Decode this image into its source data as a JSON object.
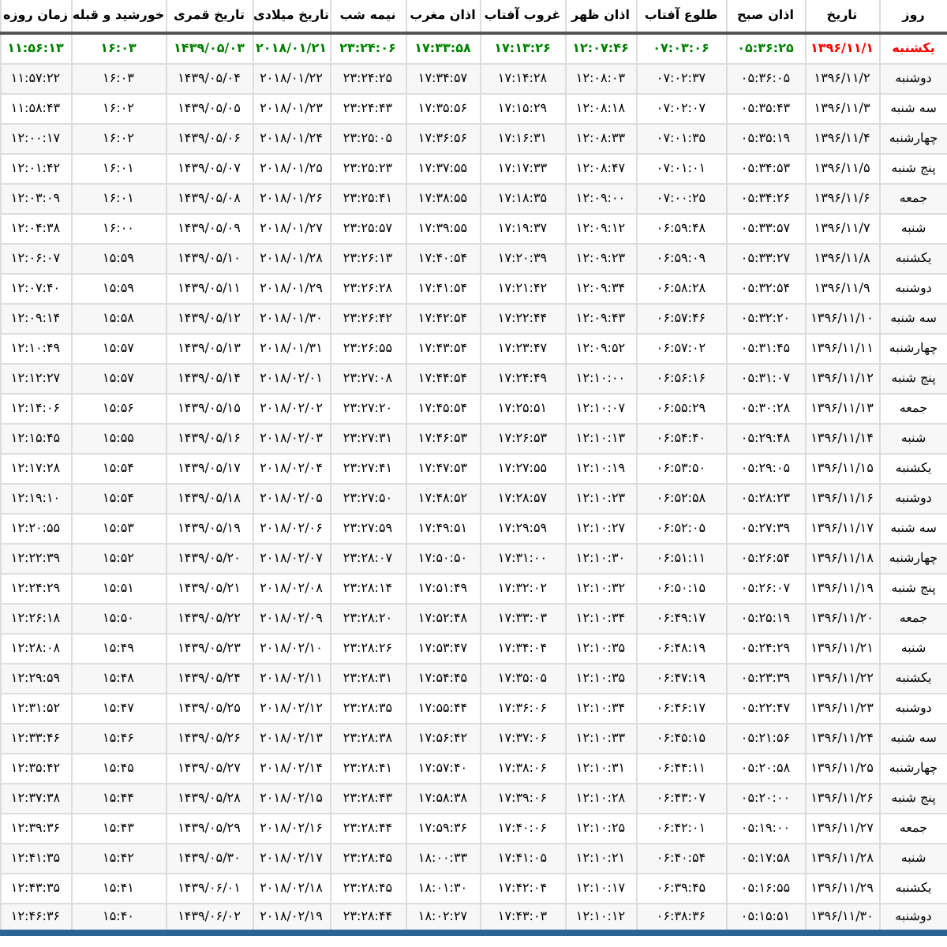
{
  "columns": [
    "روز",
    "تاریخ",
    "اذان صبح",
    "طلوع آفتاب",
    "اذان ظهر",
    "غروب آفتاب",
    "اذان مغرب",
    "نیمه شب",
    "تاریخ میلادی",
    "تاریخ قمری",
    "خورشید و قبله",
    "زمان روزه"
  ],
  "rows": [
    {
      "today": true,
      "cells": [
        "یکشنبه",
        "۱۳۹۶/۱۱/۱",
        "۰۵:۳۶:۲۵",
        "۰۷:۰۳:۰۶",
        "۱۲:۰۷:۴۶",
        "۱۷:۱۳:۲۶",
        "۱۷:۳۳:۵۸",
        "۲۳:۲۴:۰۶",
        "۲۰۱۸/۰۱/۲۱",
        "۱۴۳۹/۰۵/۰۳",
        "۱۶:۰۳",
        "۱۱:۵۶:۱۳"
      ]
    },
    {
      "today": false,
      "cells": [
        "دوشنبه",
        "۱۳۹۶/۱۱/۲",
        "۰۵:۳۶:۰۵",
        "۰۷:۰۲:۳۷",
        "۱۲:۰۸:۰۳",
        "۱۷:۱۴:۲۸",
        "۱۷:۳۴:۵۷",
        "۲۳:۲۴:۲۵",
        "۲۰۱۸/۰۱/۲۲",
        "۱۴۳۹/۰۵/۰۴",
        "۱۶:۰۳",
        "۱۱:۵۷:۲۲"
      ]
    },
    {
      "today": false,
      "cells": [
        "سه شنبه",
        "۱۳۹۶/۱۱/۳",
        "۰۵:۳۵:۴۳",
        "۰۷:۰۲:۰۷",
        "۱۲:۰۸:۱۸",
        "۱۷:۱۵:۲۹",
        "۱۷:۳۵:۵۶",
        "۲۳:۲۴:۴۳",
        "۲۰۱۸/۰۱/۲۳",
        "۱۴۳۹/۰۵/۰۵",
        "۱۶:۰۲",
        "۱۱:۵۸:۴۳"
      ]
    },
    {
      "today": false,
      "cells": [
        "چهارشنبه",
        "۱۳۹۶/۱۱/۴",
        "۰۵:۳۵:۱۹",
        "۰۷:۰۱:۳۵",
        "۱۲:۰۸:۳۳",
        "۱۷:۱۶:۳۱",
        "۱۷:۳۶:۵۶",
        "۲۳:۲۵:۰۵",
        "۲۰۱۸/۰۱/۲۴",
        "۱۴۳۹/۰۵/۰۶",
        "۱۶:۰۲",
        "۱۲:۰۰:۱۷"
      ]
    },
    {
      "today": false,
      "cells": [
        "پنج شنبه",
        "۱۳۹۶/۱۱/۵",
        "۰۵:۳۴:۵۳",
        "۰۷:۰۱:۰۱",
        "۱۲:۰۸:۴۷",
        "۱۷:۱۷:۳۳",
        "۱۷:۳۷:۵۵",
        "۲۳:۲۵:۲۳",
        "۲۰۱۸/۰۱/۲۵",
        "۱۴۳۹/۰۵/۰۷",
        "۱۶:۰۱",
        "۱۲:۰۱:۴۲"
      ]
    },
    {
      "today": false,
      "cells": [
        "جمعه",
        "۱۳۹۶/۱۱/۶",
        "۰۵:۳۴:۲۶",
        "۰۷:۰۰:۲۵",
        "۱۲:۰۹:۰۰",
        "۱۷:۱۸:۳۵",
        "۱۷:۳۸:۵۵",
        "۲۳:۲۵:۴۱",
        "۲۰۱۸/۰۱/۲۶",
        "۱۴۳۹/۰۵/۰۸",
        "۱۶:۰۱",
        "۱۲:۰۳:۰۹"
      ]
    },
    {
      "today": false,
      "cells": [
        "شنبه",
        "۱۳۹۶/۱۱/۷",
        "۰۵:۳۳:۵۷",
        "۰۶:۵۹:۴۸",
        "۱۲:۰۹:۱۲",
        "۱۷:۱۹:۳۷",
        "۱۷:۳۹:۵۵",
        "۲۳:۲۵:۵۷",
        "۲۰۱۸/۰۱/۲۷",
        "۱۴۳۹/۰۵/۰۹",
        "۱۶:۰۰",
        "۱۲:۰۴:۳۸"
      ]
    },
    {
      "today": false,
      "cells": [
        "یکشنبه",
        "۱۳۹۶/۱۱/۸",
        "۰۵:۳۳:۲۷",
        "۰۶:۵۹:۰۹",
        "۱۲:۰۹:۲۳",
        "۱۷:۲۰:۳۹",
        "۱۷:۴۰:۵۴",
        "۲۳:۲۶:۱۳",
        "۲۰۱۸/۰۱/۲۸",
        "۱۴۳۹/۰۵/۱۰",
        "۱۵:۵۹",
        "۱۲:۰۶:۰۷"
      ]
    },
    {
      "today": false,
      "cells": [
        "دوشنبه",
        "۱۳۹۶/۱۱/۹",
        "۰۵:۳۲:۵۴",
        "۰۶:۵۸:۲۸",
        "۱۲:۰۹:۳۴",
        "۱۷:۲۱:۴۲",
        "۱۷:۴۱:۵۴",
        "۲۳:۲۶:۲۸",
        "۲۰۱۸/۰۱/۲۹",
        "۱۴۳۹/۰۵/۱۱",
        "۱۵:۵۹",
        "۱۲:۰۷:۴۰"
      ]
    },
    {
      "today": false,
      "cells": [
        "سه شنبه",
        "۱۳۹۶/۱۱/۱۰",
        "۰۵:۳۲:۲۰",
        "۰۶:۵۷:۴۶",
        "۱۲:۰۹:۴۳",
        "۱۷:۲۲:۴۴",
        "۱۷:۴۲:۵۴",
        "۲۳:۲۶:۴۲",
        "۲۰۱۸/۰۱/۳۰",
        "۱۴۳۹/۰۵/۱۲",
        "۱۵:۵۸",
        "۱۲:۰۹:۱۴"
      ]
    },
    {
      "today": false,
      "cells": [
        "چهارشنبه",
        "۱۳۹۶/۱۱/۱۱",
        "۰۵:۳۱:۴۵",
        "۰۶:۵۷:۰۲",
        "۱۲:۰۹:۵۲",
        "۱۷:۲۳:۴۷",
        "۱۷:۴۳:۵۴",
        "۲۳:۲۶:۵۵",
        "۲۰۱۸/۰۱/۳۱",
        "۱۴۳۹/۰۵/۱۳",
        "۱۵:۵۷",
        "۱۲:۱۰:۴۹"
      ]
    },
    {
      "today": false,
      "cells": [
        "پنج شنبه",
        "۱۳۹۶/۱۱/۱۲",
        "۰۵:۳۱:۰۷",
        "۰۶:۵۶:۱۶",
        "۱۲:۱۰:۰۰",
        "۱۷:۲۴:۴۹",
        "۱۷:۴۴:۵۴",
        "۲۳:۲۷:۰۸",
        "۲۰۱۸/۰۲/۰۱",
        "۱۴۳۹/۰۵/۱۴",
        "۱۵:۵۷",
        "۱۲:۱۲:۲۷"
      ]
    },
    {
      "today": false,
      "cells": [
        "جمعه",
        "۱۳۹۶/۱۱/۱۳",
        "۰۵:۳۰:۲۸",
        "۰۶:۵۵:۲۹",
        "۱۲:۱۰:۰۷",
        "۱۷:۲۵:۵۱",
        "۱۷:۴۵:۵۴",
        "۲۳:۲۷:۲۰",
        "۲۰۱۸/۰۲/۰۲",
        "۱۴۳۹/۰۵/۱۵",
        "۱۵:۵۶",
        "۱۲:۱۴:۰۶"
      ]
    },
    {
      "today": false,
      "cells": [
        "شنبه",
        "۱۳۹۶/۱۱/۱۴",
        "۰۵:۲۹:۴۸",
        "۰۶:۵۴:۴۰",
        "۱۲:۱۰:۱۳",
        "۱۷:۲۶:۵۳",
        "۱۷:۴۶:۵۳",
        "۲۳:۲۷:۳۱",
        "۲۰۱۸/۰۲/۰۳",
        "۱۴۳۹/۰۵/۱۶",
        "۱۵:۵۵",
        "۱۲:۱۵:۴۵"
      ]
    },
    {
      "today": false,
      "cells": [
        "یکشنبه",
        "۱۳۹۶/۱۱/۱۵",
        "۰۵:۲۹:۰۵",
        "۰۶:۵۳:۵۰",
        "۱۲:۱۰:۱۹",
        "۱۷:۲۷:۵۵",
        "۱۷:۴۷:۵۳",
        "۲۳:۲۷:۴۱",
        "۲۰۱۸/۰۲/۰۴",
        "۱۴۳۹/۰۵/۱۷",
        "۱۵:۵۴",
        "۱۲:۱۷:۲۸"
      ]
    },
    {
      "today": false,
      "cells": [
        "دوشنبه",
        "۱۳۹۶/۱۱/۱۶",
        "۰۵:۲۸:۲۳",
        "۰۶:۵۲:۵۸",
        "۱۲:۱۰:۲۳",
        "۱۷:۲۸:۵۷",
        "۱۷:۴۸:۵۲",
        "۲۳:۲۷:۵۰",
        "۲۰۱۸/۰۲/۰۵",
        "۱۴۳۹/۰۵/۱۸",
        "۱۵:۵۴",
        "۱۲:۱۹:۱۰"
      ]
    },
    {
      "today": false,
      "cells": [
        "سه شنبه",
        "۱۳۹۶/۱۱/۱۷",
        "۰۵:۲۷:۳۹",
        "۰۶:۵۲:۰۵",
        "۱۲:۱۰:۲۷",
        "۱۷:۲۹:۵۹",
        "۱۷:۴۹:۵۱",
        "۲۳:۲۷:۵۹",
        "۲۰۱۸/۰۲/۰۶",
        "۱۴۳۹/۰۵/۱۹",
        "۱۵:۵۳",
        "۱۲:۲۰:۵۵"
      ]
    },
    {
      "today": false,
      "cells": [
        "چهارشنبه",
        "۱۳۹۶/۱۱/۱۸",
        "۰۵:۲۶:۵۴",
        "۰۶:۵۱:۱۱",
        "۱۲:۱۰:۳۰",
        "۱۷:۳۱:۰۰",
        "۱۷:۵۰:۵۰",
        "۲۳:۲۸:۰۷",
        "۲۰۱۸/۰۲/۰۷",
        "۱۴۳۹/۰۵/۲۰",
        "۱۵:۵۲",
        "۱۲:۲۲:۳۹"
      ]
    },
    {
      "today": false,
      "cells": [
        "پنج شنبه",
        "۱۳۹۶/۱۱/۱۹",
        "۰۵:۲۶:۰۷",
        "۰۶:۵۰:۱۵",
        "۱۲:۱۰:۳۲",
        "۱۷:۳۲:۰۲",
        "۱۷:۵۱:۴۹",
        "۲۳:۲۸:۱۴",
        "۲۰۱۸/۰۲/۰۸",
        "۱۴۳۹/۰۵/۲۱",
        "۱۵:۵۱",
        "۱۲:۲۴:۲۹"
      ]
    },
    {
      "today": false,
      "cells": [
        "جمعه",
        "۱۳۹۶/۱۱/۲۰",
        "۰۵:۲۵:۱۹",
        "۰۶:۴۹:۱۷",
        "۱۲:۱۰:۳۴",
        "۱۷:۳۳:۰۳",
        "۱۷:۵۲:۴۸",
        "۲۳:۲۸:۲۰",
        "۲۰۱۸/۰۲/۰۹",
        "۱۴۳۹/۰۵/۲۲",
        "۱۵:۵۰",
        "۱۲:۲۶:۱۸"
      ]
    },
    {
      "today": false,
      "cells": [
        "شنبه",
        "۱۳۹۶/۱۱/۲۱",
        "۰۵:۲۴:۲۹",
        "۰۶:۴۸:۱۹",
        "۱۲:۱۰:۳۵",
        "۱۷:۳۴:۰۴",
        "۱۷:۵۳:۴۷",
        "۲۳:۲۸:۲۶",
        "۲۰۱۸/۰۲/۱۰",
        "۱۴۳۹/۰۵/۲۳",
        "۱۵:۴۹",
        "۱۲:۲۸:۰۸"
      ]
    },
    {
      "today": false,
      "cells": [
        "یکشنبه",
        "۱۳۹۶/۱۱/۲۲",
        "۰۵:۲۳:۳۹",
        "۰۶:۴۷:۱۹",
        "۱۲:۱۰:۳۵",
        "۱۷:۳۵:۰۵",
        "۱۷:۵۴:۴۵",
        "۲۳:۲۸:۳۱",
        "۲۰۱۸/۰۲/۱۱",
        "۱۴۳۹/۰۵/۲۴",
        "۱۵:۴۸",
        "۱۲:۲۹:۵۹"
      ]
    },
    {
      "today": false,
      "cells": [
        "دوشنبه",
        "۱۳۹۶/۱۱/۲۳",
        "۰۵:۲۲:۴۷",
        "۰۶:۴۶:۱۷",
        "۱۲:۱۰:۳۴",
        "۱۷:۳۶:۰۶",
        "۱۷:۵۵:۴۴",
        "۲۳:۲۸:۳۵",
        "۲۰۱۸/۰۲/۱۲",
        "۱۴۳۹/۰۵/۲۵",
        "۱۵:۴۷",
        "۱۲:۳۱:۵۲"
      ]
    },
    {
      "today": false,
      "cells": [
        "سه شنبه",
        "۱۳۹۶/۱۱/۲۴",
        "۰۵:۲۱:۵۶",
        "۰۶:۴۵:۱۵",
        "۱۲:۱۰:۳۳",
        "۱۷:۳۷:۰۶",
        "۱۷:۵۶:۴۲",
        "۲۳:۲۸:۳۸",
        "۲۰۱۸/۰۲/۱۳",
        "۱۴۳۹/۰۵/۲۶",
        "۱۵:۴۶",
        "۱۲:۳۳:۴۶"
      ]
    },
    {
      "today": false,
      "cells": [
        "چهارشنبه",
        "۱۳۹۶/۱۱/۲۵",
        "۰۵:۲۰:۵۸",
        "۰۶:۴۴:۱۱",
        "۱۲:۱۰:۳۱",
        "۱۷:۳۸:۰۶",
        "۱۷:۵۷:۴۰",
        "۲۳:۲۸:۴۱",
        "۲۰۱۸/۰۲/۱۴",
        "۱۴۳۹/۰۵/۲۷",
        "۱۵:۴۵",
        "۱۲:۳۵:۴۲"
      ]
    },
    {
      "today": false,
      "cells": [
        "پنج شنبه",
        "۱۳۹۶/۱۱/۲۶",
        "۰۵:۲۰:۰۰",
        "۰۶:۴۳:۰۷",
        "۱۲:۱۰:۲۸",
        "۱۷:۳۹:۰۶",
        "۱۷:۵۸:۳۸",
        "۲۳:۲۸:۴۳",
        "۲۰۱۸/۰۲/۱۵",
        "۱۴۳۹/۰۵/۲۸",
        "۱۵:۴۴",
        "۱۲:۳۷:۳۸"
      ]
    },
    {
      "today": false,
      "cells": [
        "جمعه",
        "۱۳۹۶/۱۱/۲۷",
        "۰۵:۱۹:۰۰",
        "۰۶:۴۲:۰۱",
        "۱۲:۱۰:۲۵",
        "۱۷:۴۰:۰۶",
        "۱۷:۵۹:۳۶",
        "۲۳:۲۸:۴۴",
        "۲۰۱۸/۰۲/۱۶",
        "۱۴۳۹/۰۵/۲۹",
        "۱۵:۴۳",
        "۱۲:۳۹:۳۶"
      ]
    },
    {
      "today": false,
      "cells": [
        "شنبه",
        "۱۳۹۶/۱۱/۲۸",
        "۰۵:۱۷:۵۸",
        "۰۶:۴۰:۵۴",
        "۱۲:۱۰:۲۱",
        "۱۷:۴۱:۰۵",
        "۱۸:۰۰:۳۳",
        "۲۳:۲۸:۴۵",
        "۲۰۱۸/۰۲/۱۷",
        "۱۴۳۹/۰۵/۳۰",
        "۱۵:۴۲",
        "۱۲:۴۱:۳۵"
      ]
    },
    {
      "today": false,
      "cells": [
        "یکشنبه",
        "۱۳۹۶/۱۱/۲۹",
        "۰۵:۱۶:۵۵",
        "۰۶:۳۹:۴۵",
        "۱۲:۱۰:۱۷",
        "۱۷:۴۲:۰۴",
        "۱۸:۰۱:۳۰",
        "۲۳:۲۸:۴۵",
        "۲۰۱۸/۰۲/۱۸",
        "۱۴۳۹/۰۶/۰۱",
        "۱۵:۴۱",
        "۱۲:۴۳:۳۵"
      ]
    },
    {
      "today": false,
      "cells": [
        "دوشنبه",
        "۱۳۹۶/۱۱/۳۰",
        "۰۵:۱۵:۵۱",
        "۰۶:۳۸:۳۶",
        "۱۲:۱۰:۱۲",
        "۱۷:۴۳:۰۳",
        "۱۸:۰۲:۲۷",
        "۲۳:۲۸:۴۴",
        "۲۰۱۸/۰۲/۱۹",
        "۱۴۳۹/۰۶/۰۲",
        "۱۵:۴۰",
        "۱۲:۴۶:۳۶"
      ]
    }
  ]
}
